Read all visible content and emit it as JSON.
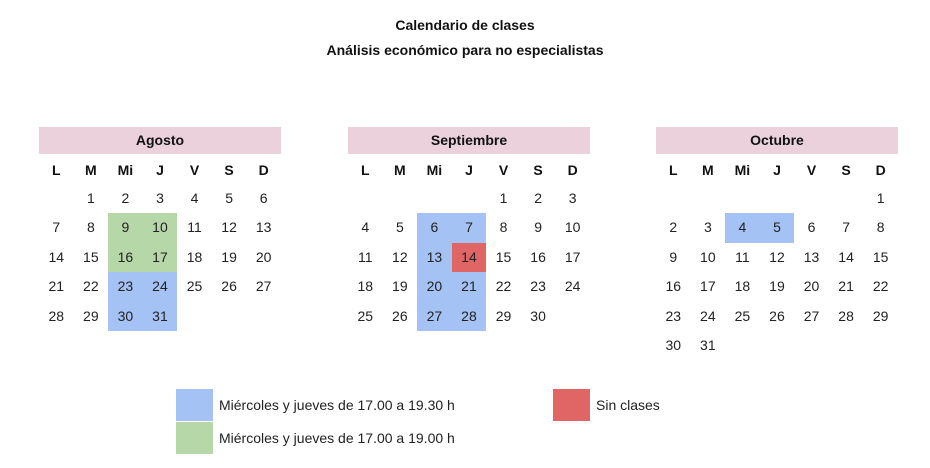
{
  "title": "Calendario de clases",
  "subtitle": "Análisis económico para no especialistas",
  "colors": {
    "header_bg": "#ead1dc",
    "blue": "#a4c2f4",
    "green": "#b6d7a8",
    "red": "#e06666"
  },
  "day_headers": [
    "L",
    "M",
    "Mi",
    "J",
    "V",
    "S",
    "D"
  ],
  "months": [
    {
      "name": "Agosto",
      "weeks": [
        [
          "",
          "1",
          "2",
          "3",
          "4",
          "5",
          "6"
        ],
        [
          "7",
          "8",
          "9",
          "10",
          "11",
          "12",
          "13"
        ],
        [
          "14",
          "15",
          "16",
          "17",
          "18",
          "19",
          "20"
        ],
        [
          "21",
          "22",
          "23",
          "24",
          "25",
          "26",
          "27"
        ],
        [
          "28",
          "29",
          "30",
          "31",
          "",
          "",
          ""
        ]
      ],
      "highlights": {
        "9": "green",
        "10": "green",
        "16": "green",
        "17": "green",
        "23": "blue",
        "24": "blue",
        "30": "blue",
        "31": "blue"
      }
    },
    {
      "name": "Septiembre",
      "weeks": [
        [
          "",
          "",
          "",
          "",
          "1",
          "2",
          "3"
        ],
        [
          "4",
          "5",
          "6",
          "7",
          "8",
          "9",
          "10"
        ],
        [
          "11",
          "12",
          "13",
          "14",
          "15",
          "16",
          "17"
        ],
        [
          "18",
          "19",
          "20",
          "21",
          "22",
          "23",
          "24"
        ],
        [
          "25",
          "26",
          "27",
          "28",
          "29",
          "30",
          ""
        ]
      ],
      "highlights": {
        "6": "blue",
        "7": "blue",
        "13": "blue",
        "14": "red",
        "20": "blue",
        "21": "blue",
        "27": "blue",
        "28": "blue"
      }
    },
    {
      "name": "Octubre",
      "weeks": [
        [
          "",
          "",
          "",
          "",
          "",
          "",
          "1"
        ],
        [
          "2",
          "3",
          "4",
          "5",
          "6",
          "7",
          "8"
        ],
        [
          "9",
          "10",
          "11",
          "12",
          "13",
          "14",
          "15"
        ],
        [
          "16",
          "17",
          "18",
          "19",
          "20",
          "21",
          "22"
        ],
        [
          "23",
          "24",
          "25",
          "26",
          "27",
          "28",
          "29"
        ],
        [
          "30",
          "31",
          "",
          "",
          "",
          "",
          ""
        ]
      ],
      "highlights": {
        "4": "blue",
        "5": "blue"
      }
    }
  ],
  "legend": [
    {
      "color": "blue",
      "label": "Miércoles y jueves de 17.00 a 19.30 h"
    },
    {
      "color": "green",
      "label": "Miércoles y jueves de 17.00 a 19.00 h"
    },
    {
      "color": "red",
      "label": "Sin clases"
    }
  ]
}
